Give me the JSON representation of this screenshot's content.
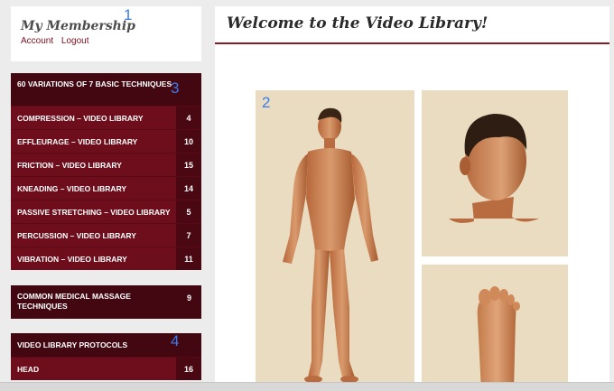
{
  "membership": {
    "title": "My Membership",
    "links": [
      "Account",
      "Logout"
    ]
  },
  "annotations": [
    "1",
    "2",
    "3",
    "4"
  ],
  "groups": [
    {
      "header": "60 Variations of 7 Basic Techniques",
      "items": [
        {
          "label": "Compression – Video Library",
          "count": "4"
        },
        {
          "label": "Effleurage – Video Library",
          "count": "10"
        },
        {
          "label": "Friction – Video Library",
          "count": "15"
        },
        {
          "label": "Kneading – Video Library",
          "count": "14"
        },
        {
          "label": "Passive Stretching – Video Library",
          "count": "5"
        },
        {
          "label": "Percussion – Video Library",
          "count": "7"
        },
        {
          "label": "Vibration – Video Library",
          "count": "11"
        }
      ]
    },
    {
      "header": "Common Medical Massage Techniques",
      "header_count": "9",
      "items": []
    },
    {
      "header": "Video Library Protocols",
      "items": [
        {
          "label": "Head",
          "count": "16"
        }
      ]
    }
  ],
  "main": {
    "heading": "Welcome to the Video Library!"
  },
  "colors": {
    "accent": "#6e0d1b",
    "accent_dark": "#420711",
    "panel_bg": "#eadcc1",
    "annotation": "#3a7bef"
  }
}
